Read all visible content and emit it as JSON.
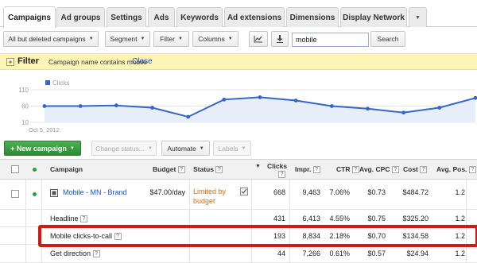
{
  "tabs": [
    {
      "label": "Campaigns",
      "active": true
    },
    {
      "label": "Ad groups"
    },
    {
      "label": "Settings"
    },
    {
      "label": "Ads"
    },
    {
      "label": "Keywords"
    },
    {
      "label": "Ad extensions"
    },
    {
      "label": "Dimensions"
    },
    {
      "label": "Display Network"
    }
  ],
  "tabs_more_glyph": "▼",
  "toolbar": {
    "filter_scope": "All but deleted campaigns",
    "segment": "Segment",
    "filter": "Filter",
    "columns": "Columns",
    "chart_icon": "chart-icon",
    "download_icon": "download-icon",
    "search_value": "mobile",
    "search_button": "Search"
  },
  "filterbar": {
    "toggle": "+",
    "title": "Filter",
    "condition": "Campaign name contains mobile",
    "close": "Close"
  },
  "chart_data": {
    "type": "line",
    "legend": "Clicks",
    "yticks": [
      "110",
      "60",
      "10"
    ],
    "ylim": [
      10,
      110
    ],
    "x_start_label": "Oct 5, 2012",
    "values": [
      60,
      60,
      62,
      55,
      27,
      80,
      87,
      77,
      60,
      52,
      40,
      55,
      85
    ],
    "color": "#3366cc"
  },
  "actions": {
    "new_campaign": "+ New campaign",
    "change_status": "Change status...",
    "automate": "Automate",
    "labels": "Labels"
  },
  "table": {
    "headers": {
      "campaign": "Campaign",
      "budget": "Budget",
      "status": "Status",
      "clicks": "Clicks",
      "impr": "Impr.",
      "ctr": "CTR",
      "avg_cpc": "Avg. CPC",
      "cost": "Cost",
      "avg_pos": "Avg. Pos."
    },
    "help_glyph": "?",
    "sort_glyph": "▼",
    "campaign_row": {
      "name": "Mobile - MN - Brand",
      "budget": "$47.00/day",
      "status_line1": "Limited by",
      "status_line2": "budget",
      "clicks": "668",
      "impr": "9,463",
      "ctr": "7.06%",
      "avg_cpc": "$0.73",
      "cost": "$484.72",
      "avg_pos": "1.2"
    },
    "rows": [
      {
        "name": "Headline",
        "clicks": "431",
        "impr": "6,413",
        "ctr": "4.55%",
        "avg_cpc": "$0.75",
        "cost": "$325.20",
        "avg_pos": "1.2"
      },
      {
        "name": "Mobile clicks-to-call",
        "clicks": "193",
        "impr": "8,834",
        "ctr": "2.18%",
        "avg_cpc": "$0.70",
        "cost": "$134.58",
        "avg_pos": "1.2"
      },
      {
        "name": "Get direction",
        "clicks": "44",
        "impr": "7,266",
        "ctr": "0.61%",
        "avg_cpc": "$0.57",
        "cost": "$24.94",
        "avg_pos": "1.2"
      }
    ]
  },
  "colors": {
    "accent_link": "#1155cc",
    "filter_bg": "#fdf5b8",
    "new_campaign_green": "#2e8b34",
    "highlight_red": "#d11919",
    "status_orange": "#e66a00"
  }
}
